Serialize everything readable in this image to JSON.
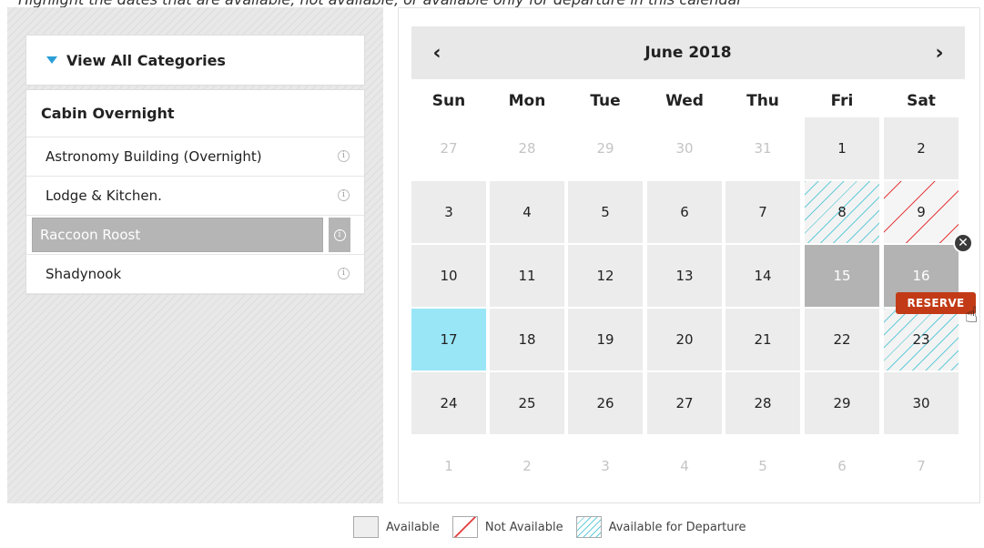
{
  "caption": "Highlight the dates that are available, not available, or available only for departure in this calendar",
  "sidebar": {
    "view_all_label": "View All Categories",
    "category_title": "Cabin Overnight",
    "items": [
      {
        "label": "Astronomy Building (Overnight)",
        "selected": false
      },
      {
        "label": "Lodge & Kitchen.",
        "selected": false
      },
      {
        "label": "Raccoon Roost",
        "selected": true
      },
      {
        "label": "Shadynook",
        "selected": false
      }
    ],
    "info_glyph": "i"
  },
  "calendar": {
    "title": "June 2018",
    "prev_label": "‹",
    "next_label": "›",
    "weekdays": [
      "Sun",
      "Mon",
      "Tue",
      "Wed",
      "Thu",
      "Fri",
      "Sat"
    ],
    "weeks": [
      [
        {
          "d": "27",
          "s": "muted"
        },
        {
          "d": "28",
          "s": "muted"
        },
        {
          "d": "29",
          "s": "muted"
        },
        {
          "d": "30",
          "s": "muted"
        },
        {
          "d": "31",
          "s": "muted"
        },
        {
          "d": "1",
          "s": "available"
        },
        {
          "d": "2",
          "s": "available"
        }
      ],
      [
        {
          "d": "3",
          "s": "available"
        },
        {
          "d": "4",
          "s": "available"
        },
        {
          "d": "5",
          "s": "available"
        },
        {
          "d": "6",
          "s": "available"
        },
        {
          "d": "7",
          "s": "available"
        },
        {
          "d": "8",
          "s": "departure"
        },
        {
          "d": "9",
          "s": "unavailable"
        }
      ],
      [
        {
          "d": "10",
          "s": "available"
        },
        {
          "d": "11",
          "s": "available"
        },
        {
          "d": "12",
          "s": "available"
        },
        {
          "d": "13",
          "s": "available"
        },
        {
          "d": "14",
          "s": "available"
        },
        {
          "d": "15",
          "s": "reserved"
        },
        {
          "d": "16",
          "s": "reserved"
        }
      ],
      [
        {
          "d": "17",
          "s": "today"
        },
        {
          "d": "18",
          "s": "available"
        },
        {
          "d": "19",
          "s": "available"
        },
        {
          "d": "20",
          "s": "available"
        },
        {
          "d": "21",
          "s": "available"
        },
        {
          "d": "22",
          "s": "available"
        },
        {
          "d": "23",
          "s": "departure"
        }
      ],
      [
        {
          "d": "24",
          "s": "available"
        },
        {
          "d": "25",
          "s": "available"
        },
        {
          "d": "26",
          "s": "available"
        },
        {
          "d": "27",
          "s": "available"
        },
        {
          "d": "28",
          "s": "available"
        },
        {
          "d": "29",
          "s": "available"
        },
        {
          "d": "30",
          "s": "available"
        }
      ],
      [
        {
          "d": "1",
          "s": "muted"
        },
        {
          "d": "2",
          "s": "muted"
        },
        {
          "d": "3",
          "s": "muted"
        },
        {
          "d": "4",
          "s": "muted"
        },
        {
          "d": "5",
          "s": "muted"
        },
        {
          "d": "6",
          "s": "muted"
        },
        {
          "d": "7",
          "s": "muted"
        }
      ]
    ],
    "reserve_label": "RESERVE",
    "close_glyph": "✕"
  },
  "legend": {
    "available": "Available",
    "not_available": "Not Available",
    "departure": "Available for Departure"
  },
  "colors": {
    "today": "#99e6f7",
    "reserved": "#b3b3b3",
    "reserve_button": "#c23b16",
    "unavailable_stripe": "#e53c3c",
    "departure_stripe": "#65ccd9",
    "accent_triangle": "#2a9fd6"
  },
  "icons": {
    "caret": "caret-down-icon",
    "info": "info-icon",
    "close": "close-icon",
    "cursor": "hand-pointer-icon"
  }
}
